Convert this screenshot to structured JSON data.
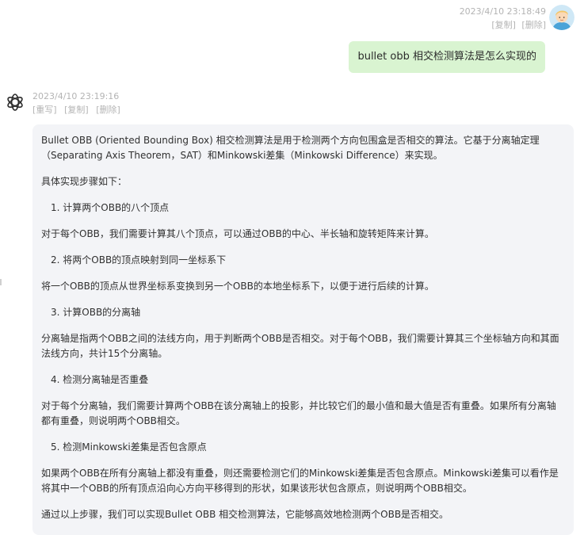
{
  "user_message": {
    "timestamp": "2023/4/10 23:18:49",
    "actions": [
      "[复制]",
      "[删除]"
    ],
    "text": "bullet obb 相交检测算法是怎么实现的",
    "avatar_icon": "user-avatar-cartoon-icon"
  },
  "bot_message": {
    "timestamp": "2023/4/10 23:19:16",
    "actions": [
      "[重写]",
      "[复制]",
      "[删除]"
    ],
    "avatar_icon": "openai-logo-icon",
    "paragraphs": {
      "intro": "Bullet OBB (Oriented Bounding Box) 相交检测算法是用于检测两个方向包围盒是否相交的算法。它基于分离轴定理（Separating Axis Theorem，SAT）和Minkowski差集（Minkowski Difference）来实现。",
      "steps_heading": "具体实现步骤如下：",
      "step1_title": "1. 计算两个OBB的八个顶点",
      "step1_body": "对于每个OBB，我们需要计算其八个顶点，可以通过OBB的中心、半长轴和旋转矩阵来计算。",
      "step2_title": "2. 将两个OBB的顶点映射到同一坐标系下",
      "step2_body": "将一个OBB的顶点从世界坐标系变换到另一个OBB的本地坐标系下，以便于进行后续的计算。",
      "step3_title": "3. 计算OBB的分离轴",
      "step3_body": "分离轴是指两个OBB之间的法线方向，用于判断两个OBB是否相交。对于每个OBB，我们需要计算其三个坐标轴方向和其面法线方向，共计15个分离轴。",
      "step4_title": "4. 检测分离轴是否重叠",
      "step4_body": "对于每个分离轴，我们需要计算两个OBB在该分离轴上的投影，并比较它们的最小值和最大值是否有重叠。如果所有分离轴都有重叠，则说明两个OBB相交。",
      "step5_title": "5. 检测Minkowski差集是否包含原点",
      "step5_body": "如果两个OBB在所有分离轴上都没有重叠，则还需要检测它们的Minkowski差集是否包含原点。Minkowski差集可以看作是将其中一个OBB的所有顶点沿向心方向平移得到的形状，如果该形状包含原点，则说明两个OBB相交。",
      "conclusion": "通过以上步骤，我们可以实现Bullet OBB 相交检测算法，它能够高效地检测两个OBB是否相交。"
    }
  },
  "colors": {
    "user_bubble": "#d9f4d1",
    "bot_bubble": "#f3f4f7",
    "meta_text": "#b4b4b4"
  }
}
